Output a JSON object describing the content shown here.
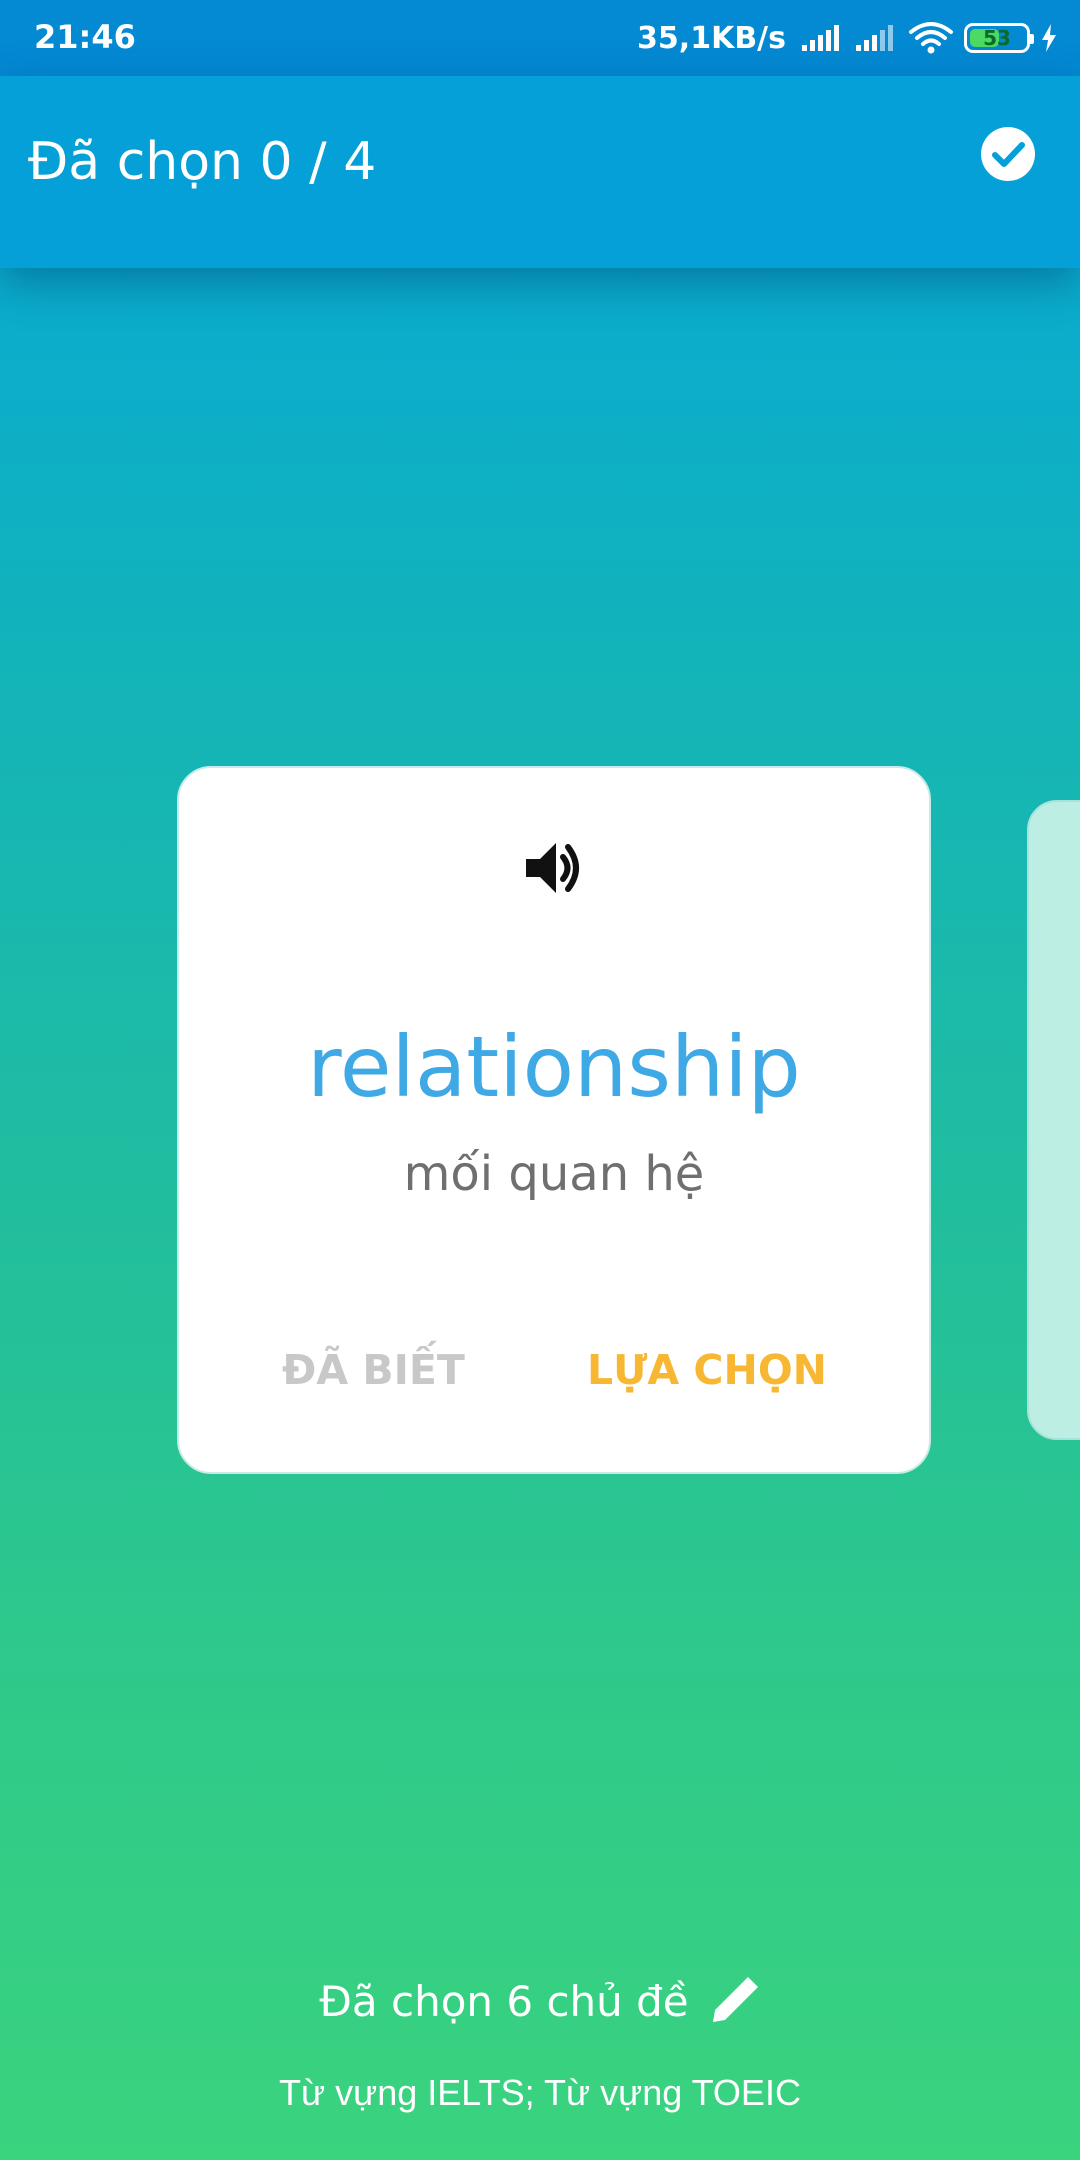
{
  "status_bar": {
    "time": "21:46",
    "net_speed": "35,1KB/s",
    "battery_level": "53",
    "battery_fraction": 0.53,
    "charging": true,
    "icons": [
      "signal-icon",
      "signal-icon",
      "wifi-icon",
      "battery-icon",
      "charging-bolt-icon"
    ]
  },
  "app_bar": {
    "title": "Đã chọn 0 / 4",
    "confirm_icon": "check-circle-icon"
  },
  "card": {
    "speaker_icon": "speaker-icon",
    "word": "relationship",
    "meaning": "mối quan hệ",
    "known_label": "ĐÃ BIẾT",
    "select_label": "LỰA CHỌN"
  },
  "footer": {
    "topics_label": "Đã chọn 6 chủ đề",
    "edit_icon": "pencil-icon",
    "topics_list": "Từ vựng IELTS; Từ vựng TOEIC"
  },
  "colors": {
    "status_bar": "#0489d3",
    "app_bar": "#04a0d7",
    "word": "#3fa9e5",
    "select_button": "#f7b733",
    "known_button": "#c8c8c8",
    "gradient_top": "#04a6d6",
    "gradient_bottom": "#3ad37e"
  }
}
